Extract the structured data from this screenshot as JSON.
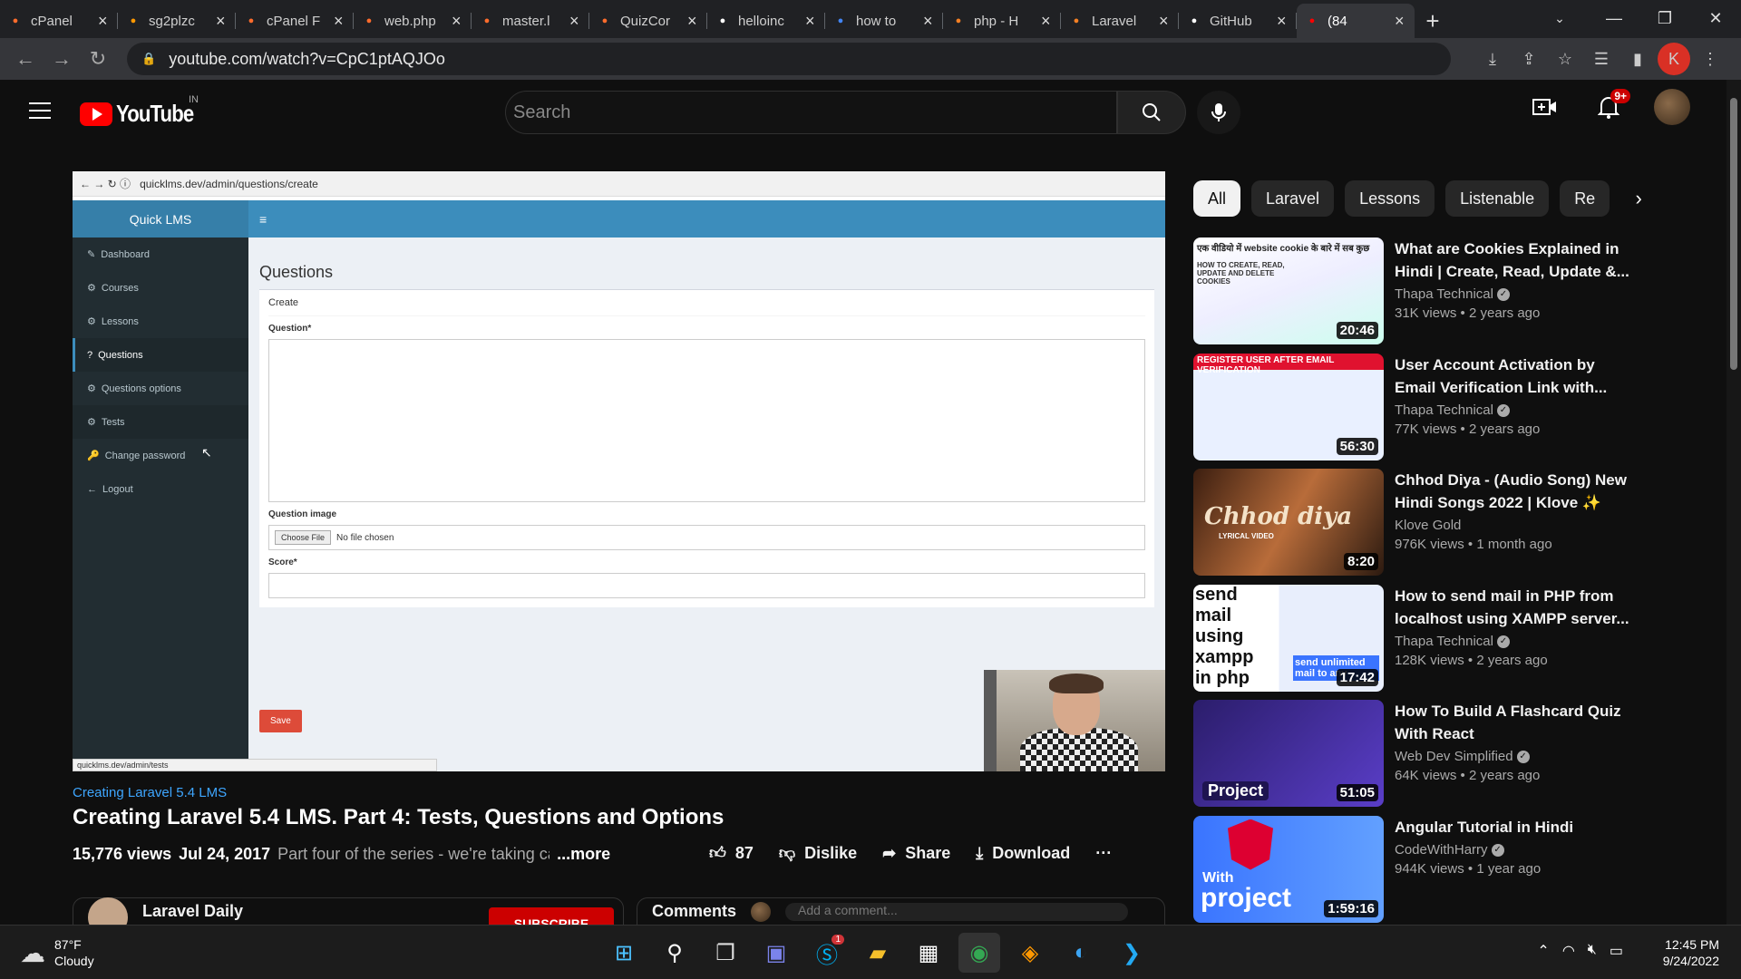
{
  "browser": {
    "tabs": [
      {
        "title": "cPanel",
        "icon": "cpanel-icon",
        "color": "#ff6c2c"
      },
      {
        "title": "sg2plzc",
        "icon": "hosting-icon",
        "color": "#ff9800"
      },
      {
        "title": "cPanel F",
        "icon": "cpanel-icon",
        "color": "#ff6c2c"
      },
      {
        "title": "web.php",
        "icon": "cpanel-icon",
        "color": "#ff6c2c"
      },
      {
        "title": "master.l",
        "icon": "cpanel-icon",
        "color": "#ff6c2c"
      },
      {
        "title": "QuizCor",
        "icon": "cpanel-icon",
        "color": "#ff6c2c"
      },
      {
        "title": "helloinc",
        "icon": "bowtie-icon",
        "color": "#ffffff"
      },
      {
        "title": "how to",
        "icon": "google-icon",
        "color": "#4285f4"
      },
      {
        "title": "php - H",
        "icon": "stackoverflow-icon",
        "color": "#f48024"
      },
      {
        "title": "Laravel",
        "icon": "stackoverflow-icon",
        "color": "#f48024"
      },
      {
        "title": "GitHub",
        "icon": "github-icon",
        "color": "#ffffff"
      },
      {
        "title": "(84",
        "icon": "youtube-icon",
        "color": "#ff0000",
        "active": true
      }
    ],
    "url": "youtube.com/watch?v=CpC1ptAQJOo",
    "profile_letter": "K"
  },
  "youtube": {
    "logo_text": "YouTube",
    "country_code": "IN",
    "search_placeholder": "Search",
    "notification_count": "9+"
  },
  "player": {
    "inner_url": "quicklms.dev/admin/questions/create",
    "lms": {
      "brand": "Quick LMS",
      "menu_toggle": "≡",
      "sidebar": [
        {
          "label": "Dashboard",
          "icon": "✎"
        },
        {
          "label": "Courses",
          "icon": "⚙"
        },
        {
          "label": "Lessons",
          "icon": "⚙"
        },
        {
          "label": "Questions",
          "icon": "?"
        },
        {
          "label": "Questions options",
          "icon": "⚙"
        },
        {
          "label": "Tests",
          "icon": "⚙"
        },
        {
          "label": "Change password",
          "icon": "🔑"
        },
        {
          "label": "Logout",
          "icon": "←"
        }
      ],
      "page_title": "Questions",
      "box_header": "Create",
      "question_label": "Question*",
      "image_label": "Question image",
      "choose_file": "Choose File",
      "no_file": "No file chosen",
      "score_label": "Score*",
      "save": "Save",
      "status_url": "quicklms.dev/admin/tests"
    }
  },
  "video": {
    "playlist_link": "Creating Laravel 5.4 LMS",
    "title": "Creating Laravel 5.4 LMS. Part 4: Tests, Questions and Options",
    "views": "15,776 views",
    "date": "Jul 24, 2017",
    "description": "Part four of the series - we're taking care",
    "more": "...more",
    "likes": "87",
    "dislike": "Dislike",
    "share": "Share",
    "download": "Download",
    "more_actions": "···",
    "channel": "Laravel Daily",
    "subscribe": "SUBSCRIBE",
    "comments_label": "Comments",
    "comment_placeholder": "Add a comment..."
  },
  "chips": [
    "All",
    "Laravel",
    "Lessons",
    "Listenable",
    "Re"
  ],
  "recommendations": [
    {
      "title": "What are Cookies Explained in Hindi | Create, Read, Update &...",
      "channel": "Thapa Technical",
      "verified": true,
      "views": "31K views",
      "age": "2 years ago",
      "duration": "20:46"
    },
    {
      "title": "User Account Activation by Email Verification Link with...",
      "channel": "Thapa Technical",
      "verified": true,
      "views": "77K views",
      "age": "2 years ago",
      "duration": "56:30"
    },
    {
      "title": "Chhod Diya - (Audio Song) New Hindi Songs 2022 | Klove ✨",
      "channel": "Klove Gold",
      "verified": false,
      "views": "976K views",
      "age": "1 month ago",
      "duration": "8:20"
    },
    {
      "title": "How to send mail in PHP from localhost using XAMPP server...",
      "channel": "Thapa Technical",
      "verified": true,
      "views": "128K views",
      "age": "2 years ago",
      "duration": "17:42"
    },
    {
      "title": "How To Build A Flashcard Quiz With React",
      "channel": "Web Dev Simplified",
      "verified": true,
      "views": "64K views",
      "age": "2 years ago",
      "duration": "51:05"
    },
    {
      "title": "Angular Tutorial in Hindi",
      "channel": "CodeWithHarry",
      "verified": true,
      "views": "944K views",
      "age": "1 year ago",
      "duration": "1:59:16"
    }
  ],
  "thumb_text": {
    "t1a": "एक वीडियो में website cookie के बारे में सब कुछ",
    "t1b": "HOW TO CREATE, READ, UPDATE AND DELETE COOKIES",
    "t2": "REGISTER USER AFTER EMAIL VERIFICATION",
    "t3a": "Chhod diya",
    "t3b": "LYRICAL VIDEO",
    "t4a": "send mail using xampp in php",
    "t4b": "send unlimited mail to any",
    "t5": "Project",
    "t6a": "With",
    "t6b": "project"
  },
  "taskbar": {
    "temp": "87°F",
    "weather": "Cloudy",
    "time": "12:45 PM",
    "date": "9/24/2022",
    "skype_badge": "1"
  }
}
